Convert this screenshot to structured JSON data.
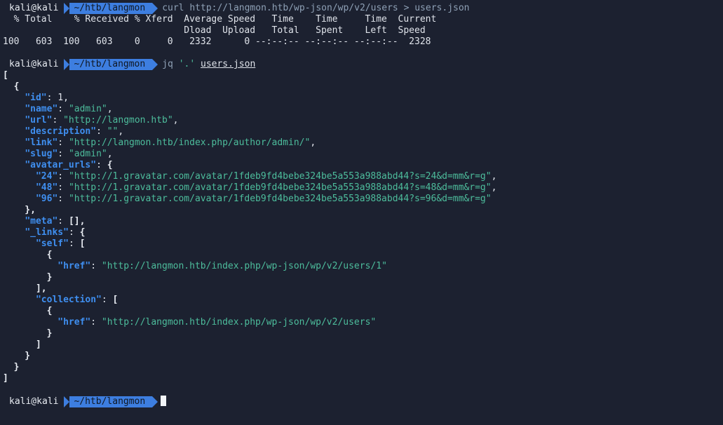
{
  "prompt": {
    "user": "kali@kali",
    "path": "~/htb/langmon"
  },
  "cmd1": {
    "text": "curl http://langmon.htb/wp-json/wp/v2/users > users.json"
  },
  "curl_header1": "  % Total    % Received % Xferd  Average Speed   Time    Time     Time  Current",
  "curl_header2": "                                 Dload  Upload   Total   Spent    Left  Speed",
  "curl_stats": "100   603  100   603    0     0   2332      0 --:--:-- --:--:-- --:--:--  2328",
  "cmd2": {
    "prog": "jq",
    "filter": "'.'",
    "file": "users.json"
  },
  "json": {
    "id_key": "\"id\"",
    "id_val": "1",
    "name_key": "\"name\"",
    "name_val": "\"admin\"",
    "url_key": "\"url\"",
    "url_val": "\"http://langmon.htb\"",
    "desc_key": "\"description\"",
    "desc_val": "\"\"",
    "link_key": "\"link\"",
    "link_val": "\"http://langmon.htb/index.php/author/admin/\"",
    "slug_key": "\"slug\"",
    "slug_val": "\"admin\"",
    "avatar_key": "\"avatar_urls\"",
    "a24_key": "\"24\"",
    "a24_val": "\"http://1.gravatar.com/avatar/1fdeb9fd4bebe324be5a553a988abd44?s=24&d=mm&r=g\"",
    "a48_key": "\"48\"",
    "a48_val": "\"http://1.gravatar.com/avatar/1fdeb9fd4bebe324be5a553a988abd44?s=48&d=mm&r=g\"",
    "a96_key": "\"96\"",
    "a96_val": "\"http://1.gravatar.com/avatar/1fdeb9fd4bebe324be5a553a988abd44?s=96&d=mm&r=g\"",
    "meta_key": "\"meta\"",
    "links_key": "\"_links\"",
    "self_key": "\"self\"",
    "href_key": "\"href\"",
    "self_href": "\"http://langmon.htb/index.php/wp-json/wp/v2/users/1\"",
    "collection_key": "\"collection\"",
    "collection_href": "\"http://langmon.htb/index.php/wp-json/wp/v2/users\""
  },
  "colors": {
    "background": "#1c2130",
    "prompt_segment": "#3d7ee0",
    "json_key": "#3f8ff0",
    "json_string": "#4dbd9c"
  }
}
